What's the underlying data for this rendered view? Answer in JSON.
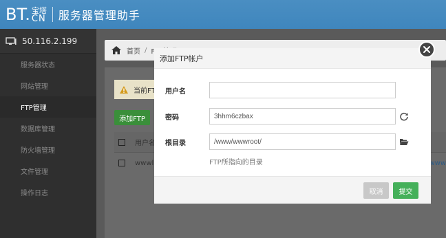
{
  "header": {
    "logo_bt": "BT.",
    "logo_cn_top": "宝塔",
    "logo_cn_bottom": "CN",
    "title": "服务器管理助手"
  },
  "sidebar": {
    "server_ip": "50.116.2.199",
    "items": [
      {
        "label": "服务器状态",
        "active": false
      },
      {
        "label": "网站管理",
        "active": false
      },
      {
        "label": "FTP管理",
        "active": true
      },
      {
        "label": "数据库管理",
        "active": false
      },
      {
        "label": "防火墙管理",
        "active": false
      },
      {
        "label": "文件管理",
        "active": false
      },
      {
        "label": "操作日志",
        "active": false
      }
    ]
  },
  "main": {
    "breadcrumb": {
      "home": "首页",
      "separator": "/",
      "current": "FTP管理"
    },
    "warning_text": "当前FT",
    "add_ftp_label": "添加FTP",
    "table": {
      "header_user": "用户名",
      "row_user": "wwwl",
      "row_link_partial": "/www"
    }
  },
  "modal": {
    "title": "添加FTP帐户",
    "username_label": "用户名",
    "username_value": "",
    "password_label": "密码",
    "password_value": "3hhm6czbax",
    "rootdir_label": "根目录",
    "rootdir_value": "/www/wwwroot/",
    "hint": "FTP所指向的目录",
    "cancel_label": "取消",
    "submit_label": "提交"
  },
  "colors": {
    "header_blue": "#3f86bd",
    "submit_green": "#45b05a",
    "addftp_green": "#3a8f3a",
    "sidebar_bg": "#2f2f2f"
  }
}
